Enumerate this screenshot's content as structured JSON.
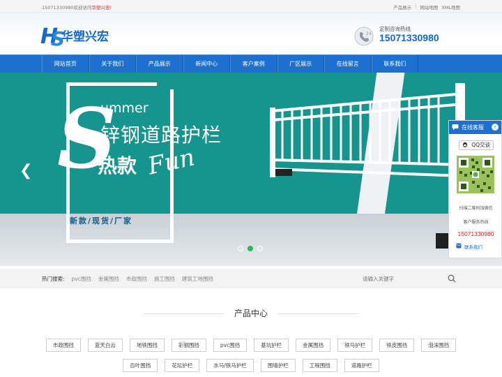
{
  "topbar": {
    "welcome_prefix": "15071330980欢迎访问",
    "welcome_highlight": "华塑兴宏",
    "welcome_suffix": "!",
    "links": [
      "产品展示",
      "网站地图",
      "XML地图"
    ]
  },
  "header": {
    "logo_text": "华塑兴宏",
    "hotline_label": "定制咨询热线",
    "hotline_number": "15071330980"
  },
  "nav": {
    "items": [
      "网站首页",
      "关于我们",
      "产品展示",
      "新闻中心",
      "客户案例",
      "厂区展示",
      "在线留言",
      "联系我们"
    ]
  },
  "banner": {
    "summer_text": "ummer",
    "product_title": "锌钢道路护栏",
    "hot_label": "热款",
    "fun_text": "Fun",
    "tagline": "新款/现货/厂家",
    "slide_count": 3,
    "active_slide": 2
  },
  "search": {
    "hot_label": "热门搜索:",
    "keywords": [
      "pvc围挡",
      "金属围挡",
      "市政围挡",
      "施工围挡",
      "建筑工地围挡"
    ],
    "placeholder": "请输入关键字"
  },
  "products": {
    "title": "产品中心",
    "row1": [
      "市政围挡",
      "蓝天白云",
      "地铁围挡",
      "彩钢围挡",
      "pvc围挡",
      "基坑护栏",
      "金属围挡",
      "铁马护栏",
      "铁皮围挡",
      "泡沫围挡"
    ],
    "row2": [
      "百叶围挡",
      "花坛护栏",
      "水马/铁马护栏",
      "围墙护栏",
      "工程围挡",
      "道路护栏"
    ]
  },
  "float_panel": {
    "title": "在线客服",
    "qq_label": "QQ交谈",
    "scan_text": "扫描二维码加微信",
    "service_label": "客户服务热线",
    "service_number": "15071330980",
    "contact_label": "联系我们"
  },
  "colors": {
    "primary": "#1d6fd0",
    "banner_teal": "#15958e",
    "accent_red": "#e02020"
  }
}
